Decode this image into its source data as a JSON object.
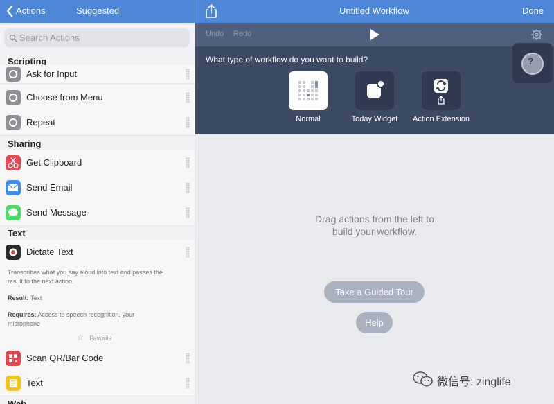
{
  "header": {
    "back_label": "Actions",
    "suggested_label": "Suggested",
    "title": "Untitled Workflow",
    "done_label": "Done"
  },
  "search": {
    "placeholder": "Search Actions"
  },
  "toolbar": {
    "undo_label": "Undo",
    "redo_label": "Redo"
  },
  "sections": {
    "scripting": "Scripting",
    "sharing": "Sharing",
    "text": "Text",
    "web": "Web"
  },
  "actions": {
    "ask_for_input": "Ask for Input",
    "choose_from_menu": "Choose from Menu",
    "repeat": "Repeat",
    "get_clipboard": "Get Clipboard",
    "send_email": "Send Email",
    "send_message": "Send Message",
    "dictate_text": "Dictate Text",
    "scan_qr": "Scan QR/Bar Code",
    "text": "Text"
  },
  "dictate_detail": {
    "description_line1": "Transcribes what you say aloud into text and passes the",
    "description_line2": "result to the next action.",
    "result_label": "Result:",
    "result_value": "Text",
    "requires_label": "Requires:",
    "requires_line1": "Access to speech recognition, your",
    "requires_line2": "microphone",
    "favorite_label": "Favorite"
  },
  "chooser": {
    "question": "What type of workflow do you want to build?",
    "types": [
      "Normal",
      "Today Widget",
      "Action Extension"
    ]
  },
  "canvas": {
    "hint_line1": "Drag actions from the left to",
    "hint_line2": "build your workflow.",
    "tour_label": "Take a Guided Tour",
    "help_label": "Help"
  },
  "watermark": {
    "text": "微信号: zinglife"
  },
  "colors": {
    "accent_blue": "#4e86d8",
    "panel_dark": "#3d4a63",
    "toolbar": "#4f5f7d",
    "pill": "#aab1bf"
  },
  "icons": {
    "back": "chevron-left-icon",
    "share": "share-icon",
    "play": "play-icon",
    "settings": "gear-icon",
    "search": "search-icon"
  }
}
